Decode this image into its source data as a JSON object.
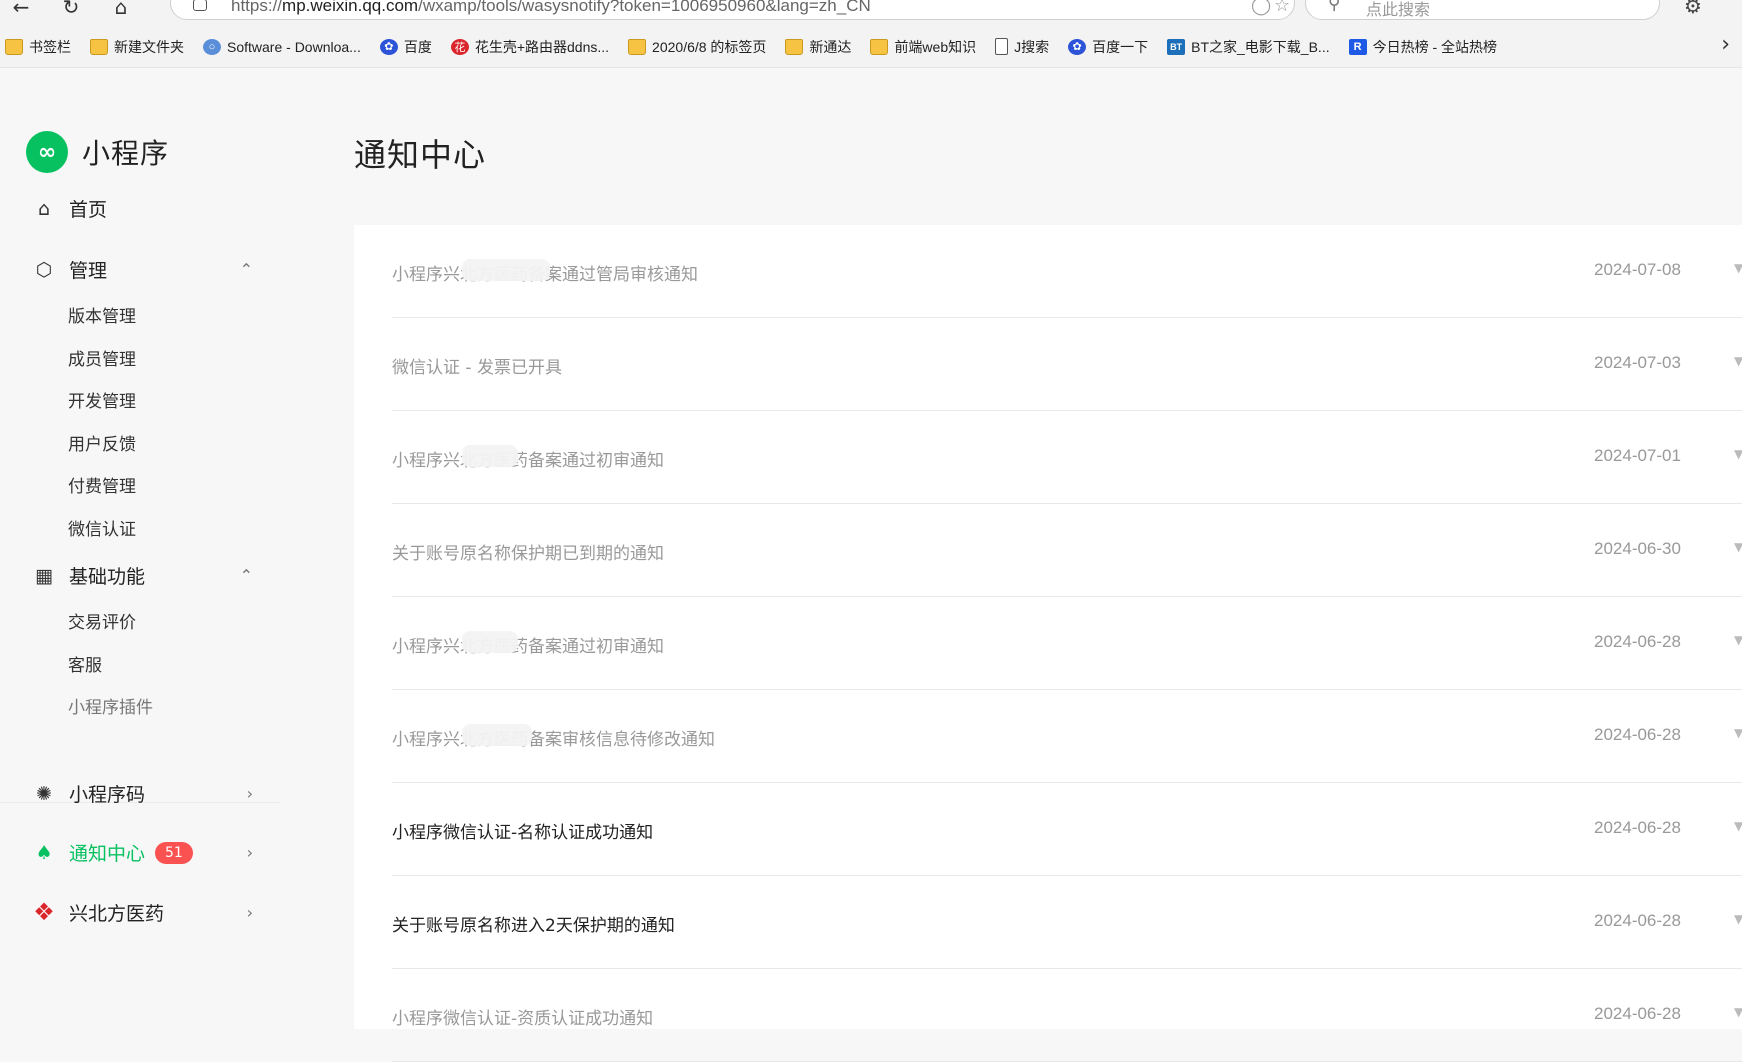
{
  "browser": {
    "url_prefix": "https://",
    "url_host": "mp.weixin.qq.com",
    "url_path": "/wxamp/tools/wasysnotify?token=1006950960&lang=zh_CN",
    "search_placeholder": "点此搜索"
  },
  "bookmarks": [
    {
      "label": "书签栏",
      "icon": "folder"
    },
    {
      "label": "新建文件夹",
      "icon": "folder"
    },
    {
      "label": "Software - Downloa...",
      "icon": "globe"
    },
    {
      "label": "百度",
      "icon": "baidu"
    },
    {
      "label": "花生壳+路由器ddns...",
      "icon": "peanut"
    },
    {
      "label": "2020/6/8 的标签页",
      "icon": "folder"
    },
    {
      "label": "新通达",
      "icon": "folder"
    },
    {
      "label": "前端web知识",
      "icon": "folder"
    },
    {
      "label": "J搜索",
      "icon": "page"
    },
    {
      "label": "百度一下",
      "icon": "baidu"
    },
    {
      "label": "BT之家_电影下载_B...",
      "icon": "bt"
    },
    {
      "label": "今日热榜 - 全站热榜",
      "icon": "r"
    }
  ],
  "sidebar": {
    "app_name": "小程序",
    "home": "首页",
    "manage": "管理",
    "manage_items": [
      "版本管理",
      "成员管理",
      "开发管理",
      "用户反馈",
      "付费管理",
      "微信认证"
    ],
    "basic": "基础功能",
    "basic_items": [
      "交易评价",
      "客服",
      "小程序插件"
    ],
    "qrcode": "小程序码",
    "notify": "通知中心",
    "notify_badge": "51",
    "account": "兴北方医药"
  },
  "page": {
    "title": "通知中心"
  },
  "notices": [
    {
      "title": "小程序兴北方医药备案通过管局审核通知",
      "date": "2024-07-08",
      "unread": false
    },
    {
      "title": "微信认证 - 发票已开具",
      "date": "2024-07-03",
      "unread": false
    },
    {
      "title": "小程序兴北方医药备案通过初审通知",
      "date": "2024-07-01",
      "unread": false
    },
    {
      "title": "关于账号原名称保护期已到期的通知",
      "date": "2024-06-30",
      "unread": false
    },
    {
      "title": "小程序兴北方医药备案通过初审通知",
      "date": "2024-06-28",
      "unread": false
    },
    {
      "title": "小程序兴北方医药备案审核信息待修改通知",
      "date": "2024-06-28",
      "unread": false
    },
    {
      "title": "小程序微信认证-名称认证成功通知",
      "date": "2024-06-28",
      "unread": true
    },
    {
      "title": "关于账号原名称进入2天保护期的通知",
      "date": "2024-06-28",
      "unread": true
    },
    {
      "title": "小程序微信认证-资质认证成功通知",
      "date": "2024-06-28",
      "unread": false
    }
  ],
  "colors": {
    "accent": "#07c160",
    "badge": "#fa5151"
  }
}
